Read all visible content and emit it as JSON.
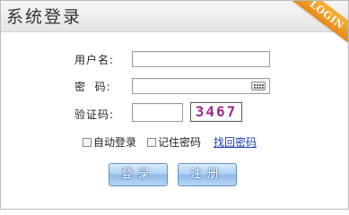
{
  "title_bar": {
    "title": "系统登录",
    "ribbon": "LOGIN"
  },
  "form": {
    "username_label": "用户名:",
    "password_label": "密  码:",
    "captcha_label": "验证码:",
    "username_value": "",
    "password_value": "",
    "captcha_value": "",
    "captcha_code": "3467"
  },
  "options": {
    "auto_login_label": "自动登录",
    "remember_password_label": "记住密码",
    "recover_password_link": "找回密码"
  },
  "buttons": {
    "login_label": "登录",
    "register_label": "注册"
  },
  "colors": {
    "ribbon": "#f0a22a",
    "captcha_text": "#9b2c8e",
    "link": "#1a3fb0",
    "button": "#8db9e8"
  }
}
